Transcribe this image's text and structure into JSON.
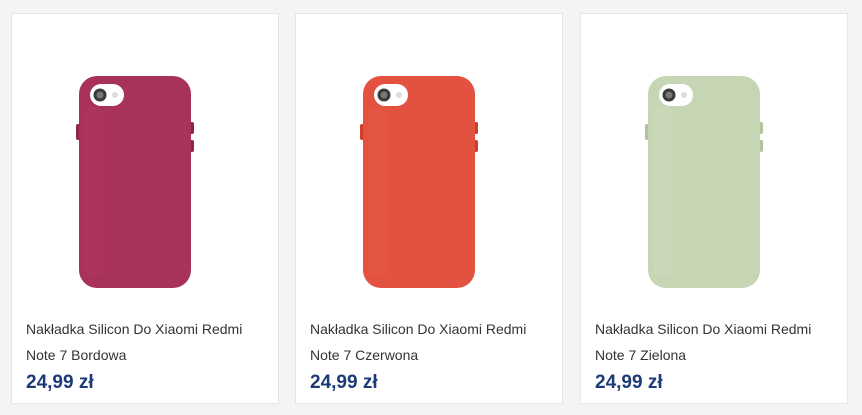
{
  "products": [
    {
      "name": "Nakładka Silicon Do Xiaomi Redmi Note 7 Bordowa",
      "price": "24,99 zł",
      "image_icon": "phone-case-icon",
      "case_color": "#a8325a",
      "case_shade": "#8f2448",
      "case_light": "#b83a68"
    },
    {
      "name": "Nakładka Silicon Do Xiaomi Redmi Note 7 Czerwona",
      "price": "24,99 zł",
      "image_icon": "phone-case-icon",
      "case_color": "#e35240",
      "case_shade": "#cf3f30",
      "case_light": "#ea5e4b"
    },
    {
      "name": "Nakładka Silicon Do Xiaomi Redmi Note 7 Zielona",
      "price": "24,99 zł",
      "image_icon": "phone-case-icon",
      "case_color": "#c6d6b4",
      "case_shade": "#b2c49f",
      "case_light": "#d3e1c3"
    }
  ]
}
